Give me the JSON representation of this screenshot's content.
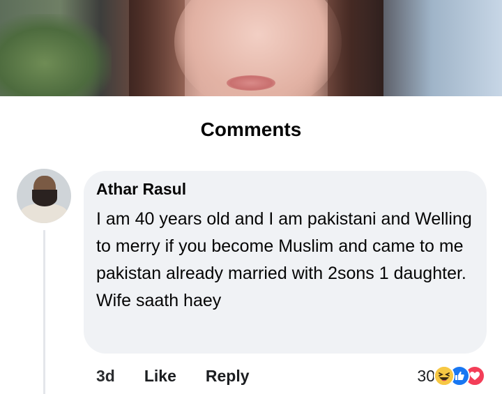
{
  "comments_section": {
    "title": "Comments"
  },
  "comment": {
    "author": "Athar Rasul",
    "text": "I am 40 years old and I am pakistani and Welling to merry if you become Muslim and came to me pakistan already married with 2sons 1 daughter. Wife saath haey",
    "timestamp": "3d",
    "like_label": "Like",
    "reply_label": "Reply",
    "reaction_count": "30",
    "reactions": [
      "haha-icon",
      "like-icon",
      "love-icon"
    ]
  },
  "colors": {
    "bubble": "#f0f2f5",
    "like_blue": "#1877f2",
    "love_red": "#f33e58",
    "haha_yellow": "#f7c844"
  }
}
